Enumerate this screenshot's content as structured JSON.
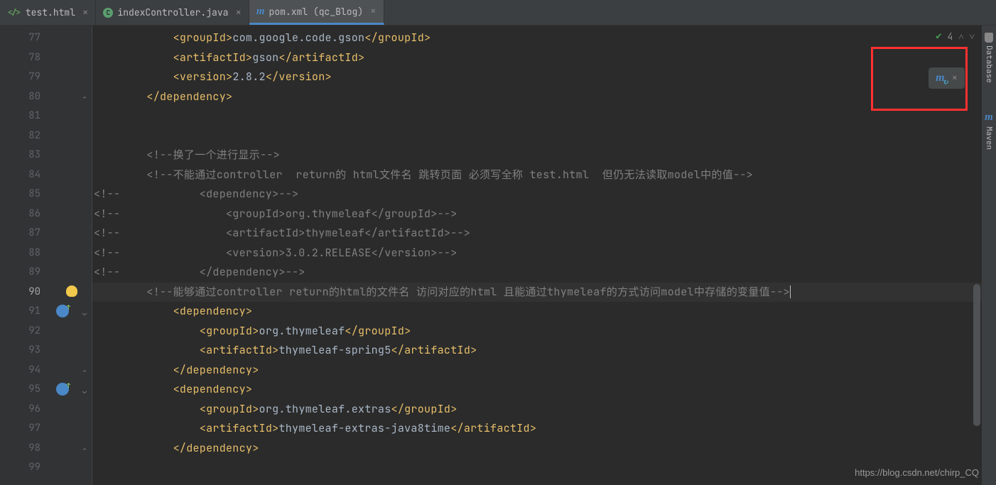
{
  "tabs": [
    {
      "label": "test.html",
      "icon": "html",
      "active": false
    },
    {
      "label": "indexController.java",
      "icon": "java",
      "active": false
    },
    {
      "label": "pom.xml (qc_Blog)",
      "icon": "maven",
      "active": true
    }
  ],
  "statusBar": {
    "problems": "4"
  },
  "rightTools": {
    "database": "Database",
    "maven": "Maven"
  },
  "gutter": {
    "start": 77,
    "end": 99,
    "current": 90
  },
  "code": {
    "l77": {
      "indent": "            ",
      "t1": "<groupId>",
      "v1": "com.google.code.gson",
      "t2": "</groupId>"
    },
    "l78": {
      "indent": "            ",
      "t1": "<artifactId>",
      "v1": "gson",
      "t2": "</artifactId>"
    },
    "l79": {
      "indent": "            ",
      "t1": "<version>",
      "v1": "2.8.2",
      "t2": "</version>"
    },
    "l80": {
      "indent": "        ",
      "t1": "</dependency>"
    },
    "l81": "",
    "l82": "",
    "l83": {
      "indent": "        ",
      "c": "<!--换了一个进行显示-->"
    },
    "l84": {
      "indent": "        ",
      "c": "<!--不能通过controller  return的 html文件名 跳转页面 必须写全称 test.html  但仍无法读取model中的值-->"
    },
    "l85": {
      "c": "<!--            <dependency>-->"
    },
    "l86": {
      "c": "<!--                <groupId>org.thymeleaf</groupId>-->"
    },
    "l87": {
      "c": "<!--                <artifactId>thymeleaf</artifactId>-->"
    },
    "l88": {
      "c": "<!--                <version>3.0.2.RELEASE</version>-->"
    },
    "l89": {
      "c": "<!--            </dependency>-->"
    },
    "l90": {
      "indent": "        ",
      "c": "<!--能够通过controller return的html的文件名 访问对应的html 且能通过thymeleaf的方式访问model中存储的变量值-->"
    },
    "l91": {
      "indent": "            ",
      "t1": "<dependency>"
    },
    "l92": {
      "indent": "                ",
      "t1": "<groupId>",
      "v1": "org.thymeleaf",
      "t2": "</groupId>"
    },
    "l93": {
      "indent": "                ",
      "t1": "<artifactId>",
      "v1": "thymeleaf-spring5",
      "t2": "</artifactId>"
    },
    "l94": {
      "indent": "            ",
      "t1": "</dependency>"
    },
    "l95": {
      "indent": "            ",
      "t1": "<dependency>"
    },
    "l96": {
      "indent": "                ",
      "t1": "<groupId>",
      "v1": "org.thymeleaf.extras",
      "t2": "</groupId>"
    },
    "l97": {
      "indent": "                ",
      "t1": "<artifactId>",
      "v1": "thymeleaf-extras-java8time",
      "t2": "</artifactId>"
    },
    "l98": {
      "indent": "            ",
      "t1": "</dependency>"
    },
    "l99": ""
  },
  "watermark": "https://blog.csdn.net/chirp_CQ"
}
